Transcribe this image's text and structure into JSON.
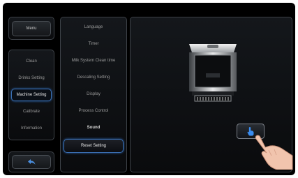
{
  "menu": {
    "label": "Menu"
  },
  "categories": [
    {
      "label": "Clean"
    },
    {
      "label": "Drinks Setting"
    },
    {
      "label": "Machine Setting"
    },
    {
      "label": "Calibrate"
    },
    {
      "label": "Information"
    }
  ],
  "settings": [
    {
      "label": "Language"
    },
    {
      "label": "Timer"
    },
    {
      "label": "Milk System Clean time"
    },
    {
      "label": "Descaling Setting"
    },
    {
      "label": "Display"
    },
    {
      "label": "Process Control"
    },
    {
      "label": "Sound"
    }
  ],
  "reset": {
    "label": "Reset Setting"
  },
  "icons": {
    "back": "back-arrow-icon",
    "touch": "touch-hand-icon"
  },
  "colors": {
    "accent": "#3a6fb3",
    "background": "#000000"
  }
}
